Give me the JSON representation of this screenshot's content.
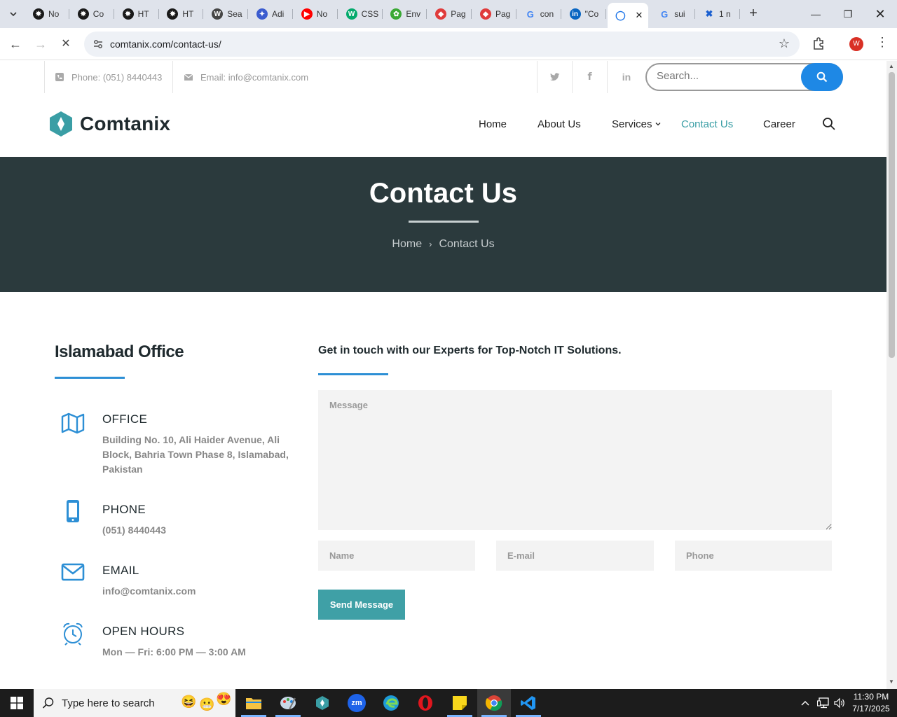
{
  "browser": {
    "tabs": [
      {
        "label": "No",
        "icon": "chatgpt-icon",
        "color": "#1a1a1a"
      },
      {
        "label": "Co",
        "icon": "chatgpt-icon",
        "color": "#1a1a1a"
      },
      {
        "label": "HT",
        "icon": "chatgpt-icon",
        "color": "#1a1a1a"
      },
      {
        "label": "HT",
        "icon": "chatgpt-icon",
        "color": "#1a1a1a"
      },
      {
        "label": "Sea",
        "icon": "wordpress-icon",
        "color": "#464646"
      },
      {
        "label": "Adi",
        "icon": "bird-icon",
        "color": "#3b5ccf"
      },
      {
        "label": "No",
        "icon": "youtube-icon",
        "color": "#ff0000"
      },
      {
        "label": "CSS",
        "icon": "w3schools-icon",
        "color": "#04aa6d"
      },
      {
        "label": "Env",
        "icon": "envato-icon",
        "color": "#3ba935"
      },
      {
        "label": "Pag",
        "icon": "page-icon",
        "color": "#e03c3c"
      },
      {
        "label": "Pag",
        "icon": "page-icon",
        "color": "#e03c3c"
      },
      {
        "label": "con",
        "icon": "google-icon",
        "color": "#4285f4"
      },
      {
        "label": "\"Co",
        "icon": "linkedin-icon",
        "color": "#0a66c2"
      },
      {
        "label": "",
        "icon": "loading-icon",
        "color": "#1a73e8",
        "active": true
      },
      {
        "label": "sui",
        "icon": "google-icon",
        "color": "#4285f4"
      },
      {
        "label": "1 n",
        "icon": "x-tools-icon",
        "color": "#1a5fd0"
      }
    ],
    "url": "comtanix.com/contact-us/",
    "profile_initial": "W"
  },
  "site": {
    "topbar": {
      "phone": "Phone: (051) 8440443",
      "email": "Email: info@comtanix.com",
      "search_placeholder": "Search..."
    },
    "brand": "Comtanix",
    "nav": [
      {
        "label": "Home",
        "current": false
      },
      {
        "label": "About Us",
        "current": false
      },
      {
        "label": "Services",
        "current": false,
        "dropdown": true
      },
      {
        "label": "Contact Us",
        "current": true
      },
      {
        "label": "Career",
        "current": false
      }
    ],
    "hero": {
      "title": "Contact Us",
      "breadcrumb_home": "Home",
      "breadcrumb_current": "Contact Us"
    },
    "office": {
      "title": "Islamabad Office",
      "items": [
        {
          "heading": "OFFICE",
          "text": "Building No. 10, Ali Haider Avenue, Ali Block, Bahria Town Phase 8, Islamabad, Pakistan",
          "icon": "map-icon"
        },
        {
          "heading": "PHONE",
          "text": "(051) 8440443",
          "icon": "mobile-phone-icon"
        },
        {
          "heading": "EMAIL",
          "text": "info@comtanix.com",
          "icon": "envelope-icon"
        },
        {
          "heading": "OPEN HOURS",
          "text": "Mon — Fri: 6:00 PM — 3:00 AM",
          "icon": "alarm-clock-icon"
        }
      ]
    },
    "form": {
      "title": "Get in touch with our Experts for Top-Notch IT Solutions.",
      "message_placeholder": "Message",
      "name_placeholder": "Name",
      "email_placeholder": "E-mail",
      "phone_placeholder": "Phone",
      "submit_label": "Send Message"
    },
    "colors": {
      "accent": "#3a9ea5",
      "blue": "#2d8fd5",
      "hero_bg": "#2b3a3d"
    }
  },
  "taskbar": {
    "search_placeholder": "Type here to search",
    "time": "11:30 PM",
    "date": "7/17/2025"
  }
}
